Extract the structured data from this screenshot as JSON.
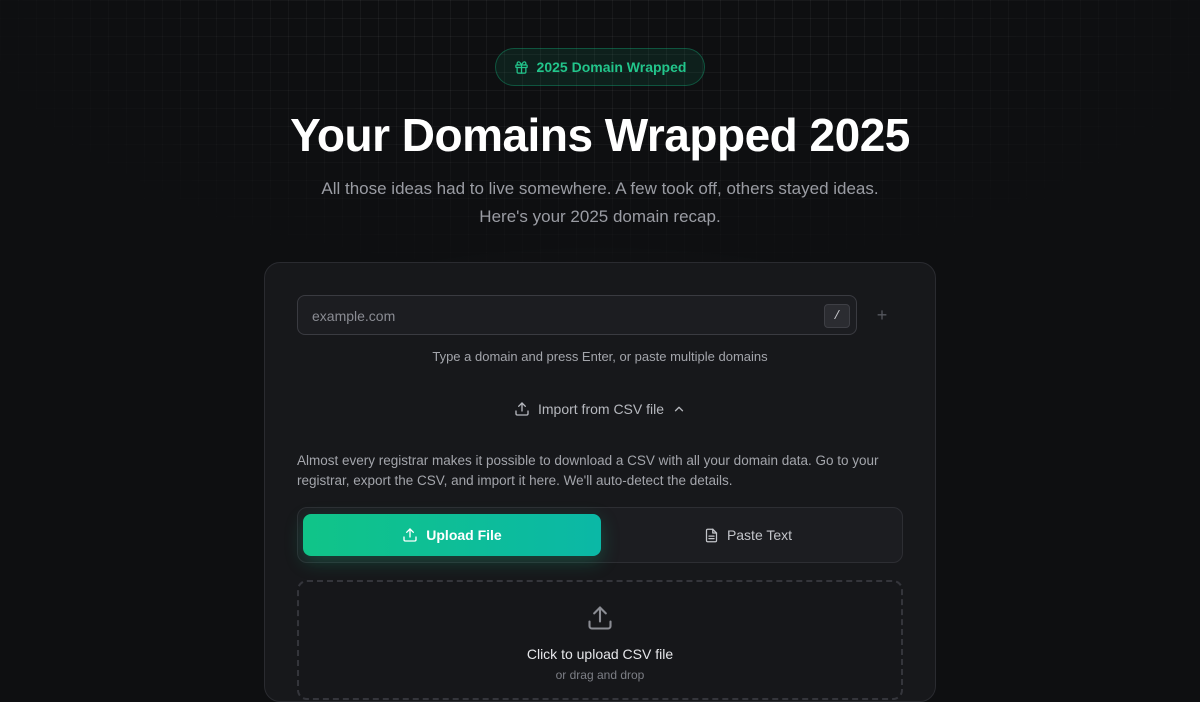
{
  "badge": {
    "label": "2025 Domain Wrapped",
    "icon": "gift-icon"
  },
  "hero": {
    "title": "Your Domains Wrapped 2025",
    "subtitle": "All those ideas had to live somewhere. A few took off, others stayed ideas. Here's your 2025 domain recap."
  },
  "domain_input": {
    "placeholder": "example.com",
    "shortcut": "/",
    "add_label": "+",
    "hint": "Type a domain and press Enter, or paste multiple domains"
  },
  "csv": {
    "toggle_label": "Import from CSV file",
    "description": "Almost every registrar makes it possible to download a CSV with all your domain data. Go to your registrar, export the CSV, and import it here. We'll auto-detect the details.",
    "tabs": [
      {
        "label": "Upload File",
        "icon": "upload-icon",
        "active": true
      },
      {
        "label": "Paste Text",
        "icon": "document-icon",
        "active": false
      }
    ],
    "dropzone": {
      "title": "Click to upload CSV file",
      "subtitle": "or drag and drop"
    }
  },
  "colors": {
    "accent": "#10c488",
    "accent_end": "#0bb8a6",
    "background": "#0e0f11",
    "card": "#17181b"
  }
}
